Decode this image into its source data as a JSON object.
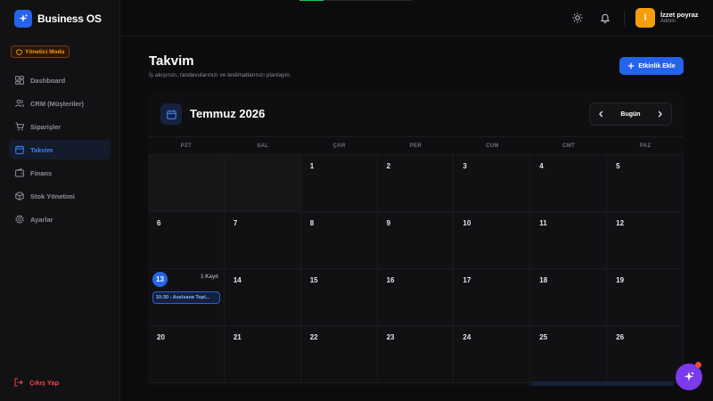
{
  "brand": {
    "name": "Business OS"
  },
  "mode_badge": "Yönetici Modu",
  "nav": [
    {
      "label": "Dashboard",
      "icon": "dashboard-icon",
      "active": false
    },
    {
      "label": "CRM (Müşteriler)",
      "icon": "users-icon",
      "active": false
    },
    {
      "label": "Siparişler",
      "icon": "cart-icon",
      "active": false
    },
    {
      "label": "Takvim",
      "icon": "calendar-icon",
      "active": true
    },
    {
      "label": "Finans",
      "icon": "wallet-icon",
      "active": false
    },
    {
      "label": "Stok Yönetimi",
      "icon": "box-icon",
      "active": false
    },
    {
      "label": "Ayarlar",
      "icon": "settings-icon",
      "active": false
    }
  ],
  "logout_label": "Çıkış Yap",
  "user": {
    "initial": "İ",
    "name": "İzzet poyraz",
    "role": "Admin"
  },
  "page": {
    "title": "Takvim",
    "subtitle": "İş akışınızı, randevularınızı ve teslimatlarınızı planlayın.",
    "add_button": "Etkinlik Ekle"
  },
  "calendar": {
    "month_label": "Temmuz 2026",
    "today_button": "Bugün",
    "weekdays": [
      "PZT",
      "SAL",
      "ÇAR",
      "PER",
      "CUM",
      "CMT",
      "PAZ"
    ],
    "days": [
      "",
      "",
      "1",
      "2",
      "3",
      "4",
      "5",
      "6",
      "7",
      "8",
      "9",
      "10",
      "11",
      "12",
      "13",
      "14",
      "15",
      "16",
      "17",
      "18",
      "19",
      "20",
      "21",
      "22",
      "23",
      "24",
      "25",
      "26"
    ],
    "today": "13",
    "today_count": "1 Kayıt",
    "today_event": "10:30 - Aselsana Topl..."
  },
  "colors": {
    "accent": "#2563eb",
    "mode_badge": "#f59e0b",
    "logout": "#ef4444",
    "fab": "#7c3aed"
  }
}
